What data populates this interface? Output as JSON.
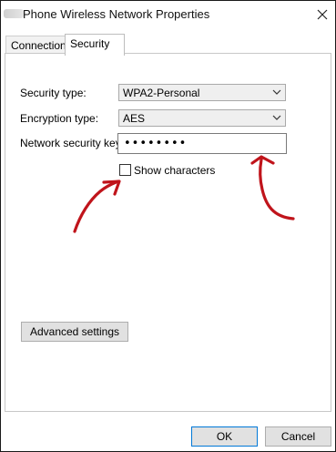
{
  "window": {
    "title": "Phone Wireless Network Properties",
    "close_icon": "close-icon"
  },
  "tabs": [
    {
      "label": "Connection"
    },
    {
      "label": "Security"
    }
  ],
  "security": {
    "security_type_label": "Security type:",
    "security_type_value": "WPA2-Personal",
    "encryption_type_label": "Encryption type:",
    "encryption_type_value": "AES",
    "network_key_label": "Network security key",
    "network_key_masked": "••••••••",
    "show_characters_label": "Show characters",
    "show_characters_checked": false
  },
  "buttons": {
    "advanced": "Advanced settings",
    "ok": "OK",
    "cancel": "Cancel"
  },
  "annotation_color": "#c0141b"
}
